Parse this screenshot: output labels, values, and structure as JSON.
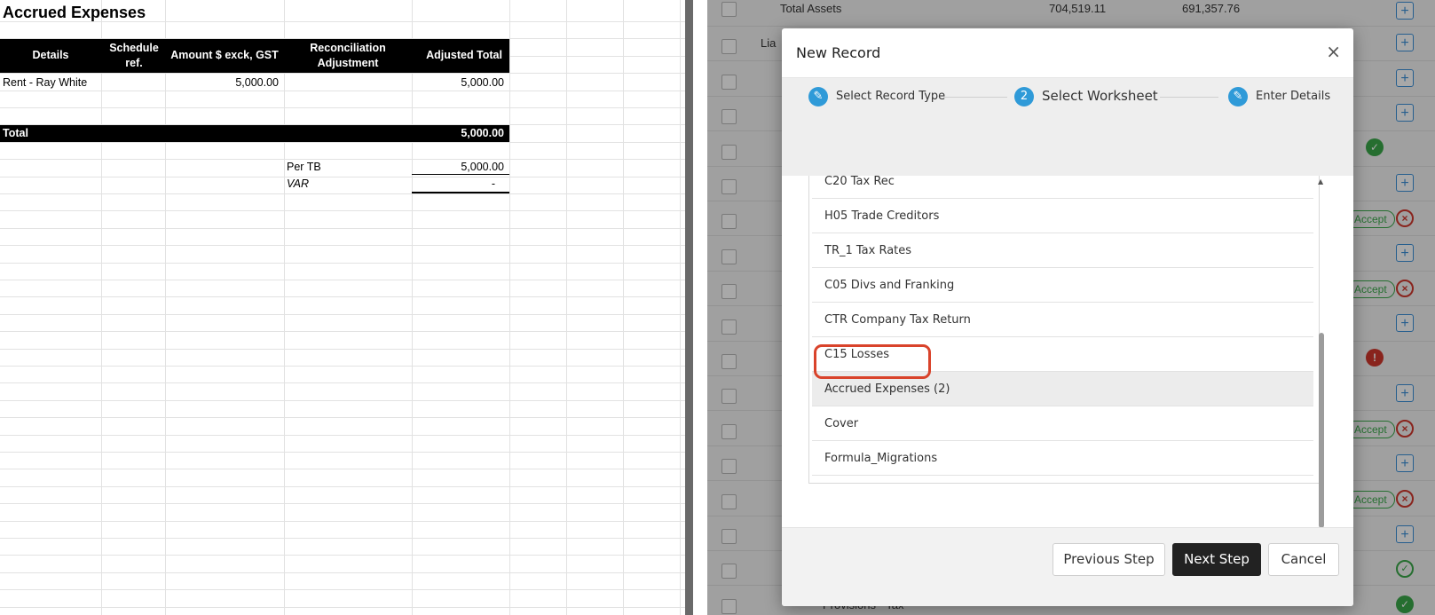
{
  "spreadsheet": {
    "title": "Accrued Expenses",
    "headers": [
      "Details",
      "Schedule ref.",
      "Amount $ exck, GST",
      "Reconciliation Adjustment",
      "Adjusted Total"
    ],
    "rows": [
      {
        "details": "Rent - Ray White",
        "amount": "5,000.00",
        "adjusted": "5,000.00"
      }
    ],
    "total_label": "Total",
    "total_value": "5,000.00",
    "per_tb_label": "Per TB",
    "per_tb_value": "5,000.00",
    "var_label": "VAR",
    "var_value": "-"
  },
  "background": {
    "row_text_1": "Total Assets",
    "row_val_1": "704,519.11",
    "row_val_2": "691,357.76",
    "row_text_2": "Lia",
    "accept_label": "Accept",
    "bottom_text": "Provisions - Tax"
  },
  "modal": {
    "title": "New Record",
    "close_glyph": "×",
    "steps": [
      {
        "icon": "✎",
        "label": "Select Record Type"
      },
      {
        "icon": "2",
        "label": "Select Worksheet"
      },
      {
        "icon": "✎",
        "label": "Enter Details"
      }
    ],
    "worksheets": [
      "C20 Tax Rec",
      "H05 Trade Creditors",
      "TR_1 Tax Rates",
      "C05 Divs and Franking",
      "CTR Company Tax Return",
      "C15 Losses",
      "Accrued Expenses (2)",
      "Cover",
      "Formula_Migrations"
    ],
    "selected_worksheet": "Accrued Expenses (2)",
    "buttons": {
      "previous": "Previous Step",
      "next": "Next Step",
      "cancel": "Cancel"
    }
  },
  "colors": {
    "accent": "#2f9ad8",
    "highlight": "#d9432b",
    "primary_button": "#222222"
  }
}
